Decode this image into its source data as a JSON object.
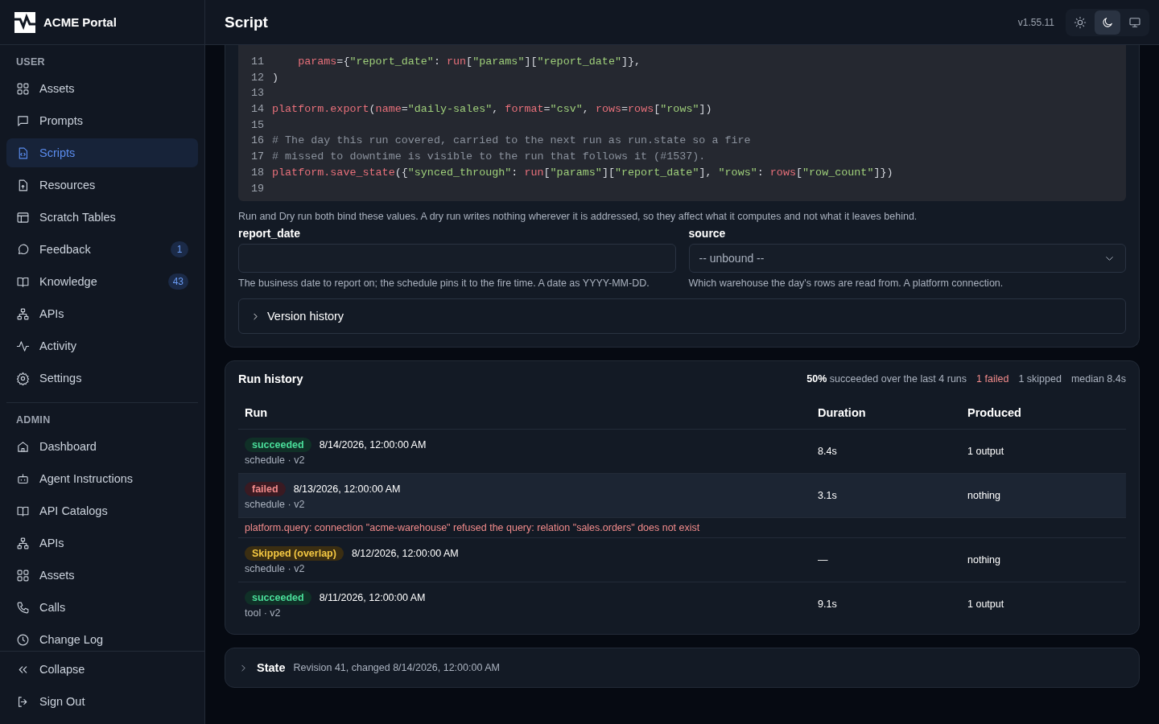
{
  "sidebar": {
    "brand": "ACME Portal",
    "sections": [
      {
        "heading": "USER",
        "items": [
          {
            "label": "Assets",
            "selected": false
          },
          {
            "label": "Prompts",
            "selected": false
          },
          {
            "label": "Scripts",
            "selected": true
          },
          {
            "label": "Resources",
            "selected": false
          },
          {
            "label": "Scratch Tables",
            "selected": false
          },
          {
            "label": "Feedback",
            "selected": false,
            "badge": "1"
          },
          {
            "label": "Knowledge",
            "selected": false,
            "badge": "43"
          },
          {
            "label": "APIs",
            "selected": false
          },
          {
            "label": "Activity",
            "selected": false
          },
          {
            "label": "Settings",
            "selected": false
          }
        ]
      },
      {
        "heading": "ADMIN",
        "items": [
          {
            "label": "Dashboard",
            "selected": false
          },
          {
            "label": "Agent Instructions",
            "selected": false
          },
          {
            "label": "API Catalogs",
            "selected": false
          },
          {
            "label": "APIs",
            "selected": false
          },
          {
            "label": "Assets",
            "selected": false
          },
          {
            "label": "Calls",
            "selected": false
          },
          {
            "label": "Change Log",
            "selected": false
          }
        ]
      }
    ],
    "footer": [
      {
        "label": "Collapse"
      },
      {
        "label": "Sign Out"
      }
    ]
  },
  "header": {
    "title": "Script",
    "version": "v1.55.11",
    "theme_toggle": [
      {
        "selected": false
      },
      {
        "selected": true
      },
      {
        "selected": false
      }
    ]
  },
  "code": {
    "lines": [
      {
        "number": "11",
        "tokens": [
          {
            "kind": "name",
            "text": "    params"
          },
          {
            "kind": "plain",
            "text": "={"
          },
          {
            "kind": "string",
            "text": "\"report_date\""
          },
          {
            "kind": "plain",
            "text": ": "
          },
          {
            "kind": "name",
            "text": "run"
          },
          {
            "kind": "plain",
            "text": "["
          },
          {
            "kind": "string",
            "text": "\"params\""
          },
          {
            "kind": "plain",
            "text": "]["
          },
          {
            "kind": "string",
            "text": "\"report_date\""
          },
          {
            "kind": "plain",
            "text": "]},"
          }
        ]
      },
      {
        "number": "12",
        "tokens": [
          {
            "kind": "plain",
            "text": ")"
          }
        ]
      },
      {
        "number": "13"
      },
      {
        "number": "14",
        "tokens": [
          {
            "kind": "name",
            "text": "platform.export"
          },
          {
            "kind": "plain",
            "text": "("
          },
          {
            "kind": "name",
            "text": "name"
          },
          {
            "kind": "plain",
            "text": "="
          },
          {
            "kind": "string",
            "text": "\"daily-sales\""
          },
          {
            "kind": "plain",
            "text": ", "
          },
          {
            "kind": "name",
            "text": "format"
          },
          {
            "kind": "plain",
            "text": "="
          },
          {
            "kind": "string",
            "text": "\"csv\""
          },
          {
            "kind": "plain",
            "text": ", "
          },
          {
            "kind": "name",
            "text": "rows"
          },
          {
            "kind": "plain",
            "text": "="
          },
          {
            "kind": "name",
            "text": "rows"
          },
          {
            "kind": "plain",
            "text": "["
          },
          {
            "kind": "string",
            "text": "\"rows\""
          },
          {
            "kind": "plain",
            "text": "])"
          }
        ]
      },
      {
        "number": "15"
      },
      {
        "number": "16",
        "tokens": [
          {
            "kind": "comment",
            "text": "# The day this run covered, carried to the next run as run.state so a fire"
          }
        ]
      },
      {
        "number": "17",
        "tokens": [
          {
            "kind": "comment",
            "text": "# missed to downtime is visible to the run that follows it (#1537)."
          }
        ]
      },
      {
        "number": "18",
        "tokens": [
          {
            "kind": "name",
            "text": "platform.save_state"
          },
          {
            "kind": "plain",
            "text": "({"
          },
          {
            "kind": "string",
            "text": "\"synced_through\""
          },
          {
            "kind": "plain",
            "text": ": "
          },
          {
            "kind": "name",
            "text": "run"
          },
          {
            "kind": "plain",
            "text": "["
          },
          {
            "kind": "string",
            "text": "\"params\""
          },
          {
            "kind": "plain",
            "text": "]["
          },
          {
            "kind": "string",
            "text": "\"report_date\""
          },
          {
            "kind": "plain",
            "text": "], "
          },
          {
            "kind": "string",
            "text": "\"rows\""
          },
          {
            "kind": "plain",
            "text": ": "
          },
          {
            "kind": "name",
            "text": "rows"
          },
          {
            "kind": "plain",
            "text": "["
          },
          {
            "kind": "string",
            "text": "\"row_count\""
          },
          {
            "kind": "plain",
            "text": "]})"
          }
        ]
      },
      {
        "number": "19"
      }
    ]
  },
  "params_note": "Run and Dry run both bind these values. A dry run writes nothing wherever it is addressed, so they affect what it computes and not what it leaves behind.",
  "params": [
    {
      "kind": "text",
      "label": "report_date",
      "help": "The business date to report on; the schedule pins it to the fire time. A date as YYYY-MM-DD."
    },
    {
      "kind": "select",
      "label": "source",
      "value": "-- unbound --",
      "help": "Which warehouse the day's rows are read from. A platform connection."
    }
  ],
  "version_history": {
    "label": "Version history",
    "expanded": false
  },
  "run_history": {
    "title": "Run history",
    "summary": [
      {
        "kind": "plain",
        "text": "**50%** succeeded over the last 4 runs"
      },
      {
        "kind": "failed",
        "text": "1 failed"
      },
      {
        "kind": "plain",
        "text": "1 skipped"
      },
      {
        "kind": "plain",
        "text": "median 8.4s"
      }
    ],
    "columns": [
      "Run",
      "Duration",
      "Produced"
    ],
    "rows": [
      {
        "kind": "succeeded",
        "status_label": "succeeded",
        "time": "8/14/2026, 12:00:00 AM",
        "source": "schedule · v2",
        "duration": "8.4s",
        "produced": "1 output",
        "selected": false
      },
      {
        "kind": "failed",
        "status_label": "failed",
        "time": "8/13/2026, 12:00:00 AM",
        "source": "schedule · v2",
        "duration": "3.1s",
        "produced": "nothing",
        "selected": true,
        "error": "platform.query: connection \"acme-warehouse\" refused the query: relation \"sales.orders\" does not exist"
      },
      {
        "kind": "skipped",
        "status_label": "Skipped (overlap)",
        "time": "8/12/2026, 12:00:00 AM",
        "source": "schedule · v2",
        "duration": "—",
        "produced": "nothing",
        "selected": false
      },
      {
        "kind": "succeeded",
        "status_label": "succeeded",
        "time": "8/11/2026, 12:00:00 AM",
        "source": "tool · v2",
        "duration": "9.1s",
        "produced": "1 output",
        "selected": false
      }
    ]
  },
  "state": {
    "title": "State",
    "detail": "Revision 41, changed 8/14/2026, 12:00:00 AM",
    "expanded": false
  }
}
